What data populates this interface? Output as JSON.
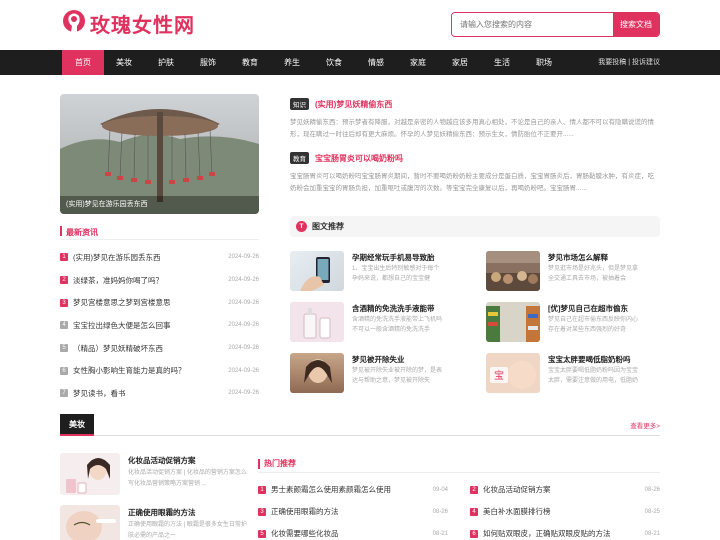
{
  "site": {
    "logo_text": "玫瑰女性网",
    "brand_color": "#e0325f"
  },
  "search": {
    "placeholder": "请输入您搜索的内容",
    "button": "搜索文档"
  },
  "nav": {
    "items": [
      "首页",
      "美妆",
      "护肤",
      "服饰",
      "教育",
      "养生",
      "饮食",
      "情感",
      "家庭",
      "家居",
      "生活",
      "职场"
    ],
    "active": "首页",
    "right": "我要投稿 | 投诉建议"
  },
  "hero": {
    "caption": "(实用)梦见在游乐园丢东西"
  },
  "latest": {
    "title": "最新资讯",
    "items": [
      {
        "n": "1",
        "text": "(实用)梦见在游乐园丢东西",
        "date": "2024-09-26"
      },
      {
        "n": "2",
        "text": "淡绿茶，准妈妈你喝了吗？",
        "date": "2024-09-26"
      },
      {
        "n": "3",
        "text": "梦见宫楼意思之梦到宫楼意思",
        "date": "2024-09-26"
      },
      {
        "n": "4",
        "text": "宝宝拉出绿色大便是怎么回事",
        "date": "2024-09-26"
      },
      {
        "n": "5",
        "text": "（精品）梦见妖精破坏东西",
        "date": "2024-09-26"
      },
      {
        "n": "6",
        "text": "女性胸小影响生育能力是真的吗？",
        "date": "2024-09-26"
      },
      {
        "n": "7",
        "text": "梦见读书，看书",
        "date": "2024-09-26"
      }
    ]
  },
  "articles": [
    {
      "tag": "知识",
      "title": "(实用)梦见妖精偷东西",
      "desc": "梦见妖精偷东西：预示梦者有降服，对越是亲密的人物越应该多用真心相处，不论是自己的亲人、情人都不可以有隐瞒说谎的情形，现在瞒过一时往后却有更大麻烦。怀孕的人梦见妖精偷东西：预示生女，情防胎位不正要开......"
    },
    {
      "tag": "教育",
      "title": "宝宝肠胃炎可以喝奶粉吗",
      "desc": "宝宝肠胃炎可以喝奶粉吗宝宝肠胃炎期间，暂时不要喝奶粉奶粉主要成分是蛋白质，宝宝胃肠炎后，胃肠黏膜水肿，有炎症，吃奶粉会加重宝宝的胃肠负担，加重呕吐或腹泻的次数。等宝宝完全康复以后，再喝奶粉吧。宝宝肠胃......"
    }
  ],
  "recommend": {
    "badge": "T",
    "title": "图文推荐",
    "items": [
      {
        "title": "孕期经常玩手机易导致胎",
        "desc": "1、宝宝出生后特别敏感对于每个孕妈来说，都想自己的宝宝健"
      },
      {
        "title": "梦见市场怎么解释",
        "desc": "梦见逛市场是好兆头，但是梦见拿全交通工具去市场，被抽着会"
      },
      {
        "title": "含酒精的免洗洗手液能带",
        "desc": "含酒精的免洗洗手液能带上飞机吗不可以一般含酒精的免洗洗手"
      },
      {
        "title": "[优]梦见自己在超市偷东",
        "desc": "梦见自己在超市偷东西反映你内心存在着对某些东西强烈的好奇"
      },
      {
        "title": "梦见被开除失业",
        "desc": "梦见被开除失业被开除的梦，是表达与帮助之意，梦见被开除失"
      },
      {
        "title": "宝宝太胖要喝低脂奶粉吗",
        "desc": "宝宝太胖要喝低脂奶粉吗因为宝宝太胖，需要注意做的用电，低脂奶粉会比较好"
      }
    ]
  },
  "beauty": {
    "tab": "美妆",
    "more": "查看更多>",
    "items": [
      {
        "title": "化妆品活动促销方案",
        "desc": "化妆品活动促销方案 | 化妆品的营销方案怎么写化妆品营销策略方案营销 ..."
      },
      {
        "title": "正确使用眼霜的方法",
        "desc": "正确使用眼霜的方法 | 眼霜是很多女生日常护肤必需的产品之一"
      }
    ]
  },
  "hot": {
    "title": "热门推荐",
    "items": [
      {
        "n": "1",
        "text": "男士素颜霜怎么使用素颜霜怎么使用",
        "date": "09-04"
      },
      {
        "n": "2",
        "text": "化妆品活动促销方案",
        "date": "08-26"
      },
      {
        "n": "3",
        "text": "正确使用眼霜的方法",
        "date": "08-26"
      },
      {
        "n": "4",
        "text": "美白补水面膜排行榜",
        "date": "08-25"
      },
      {
        "n": "5",
        "text": "化妆需要哪些化妆品",
        "date": "08-21"
      },
      {
        "n": "6",
        "text": "如何贴双眼皮，正确贴双眼皮贴的方法",
        "date": "08-21"
      }
    ]
  }
}
